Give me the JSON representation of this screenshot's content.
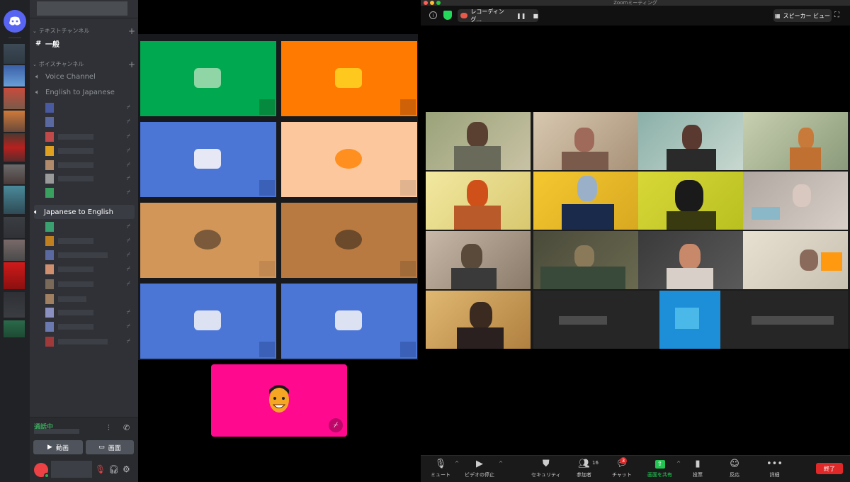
{
  "discord": {
    "text_category": "テキストチャンネル",
    "text_channel": "一般",
    "voice_category": "ボイスチャンネル",
    "voice_channels": [
      "Voice Channel",
      "English to Japanese",
      "Japanese to English"
    ],
    "voice_status": "通話中",
    "video_button": "動画",
    "screen_button": "画面",
    "accent": "#5865f2"
  },
  "stage": {
    "tile_colors": [
      "#00a84f",
      "#ff7a00",
      "#4b76d6",
      "#fcc79c",
      "#d29658",
      "#b97a42",
      "#4b76d6",
      "#4b76d6"
    ],
    "self_color": "#ff0a8e"
  },
  "zoom": {
    "window_title": "Zoomミーティング",
    "recording_label": "レコーディング...",
    "view_label": "スピーカー ビュー",
    "toolbar": {
      "mute": "ミュート",
      "video": "ビデオの停止",
      "security": "セキュリティ",
      "participants": "参加者",
      "participants_count": "16",
      "chat": "チャット",
      "chat_badge": "3",
      "share": "画面を共有",
      "polls": "投票",
      "reactions": "反応",
      "more": "詳細",
      "end": "終了"
    }
  }
}
